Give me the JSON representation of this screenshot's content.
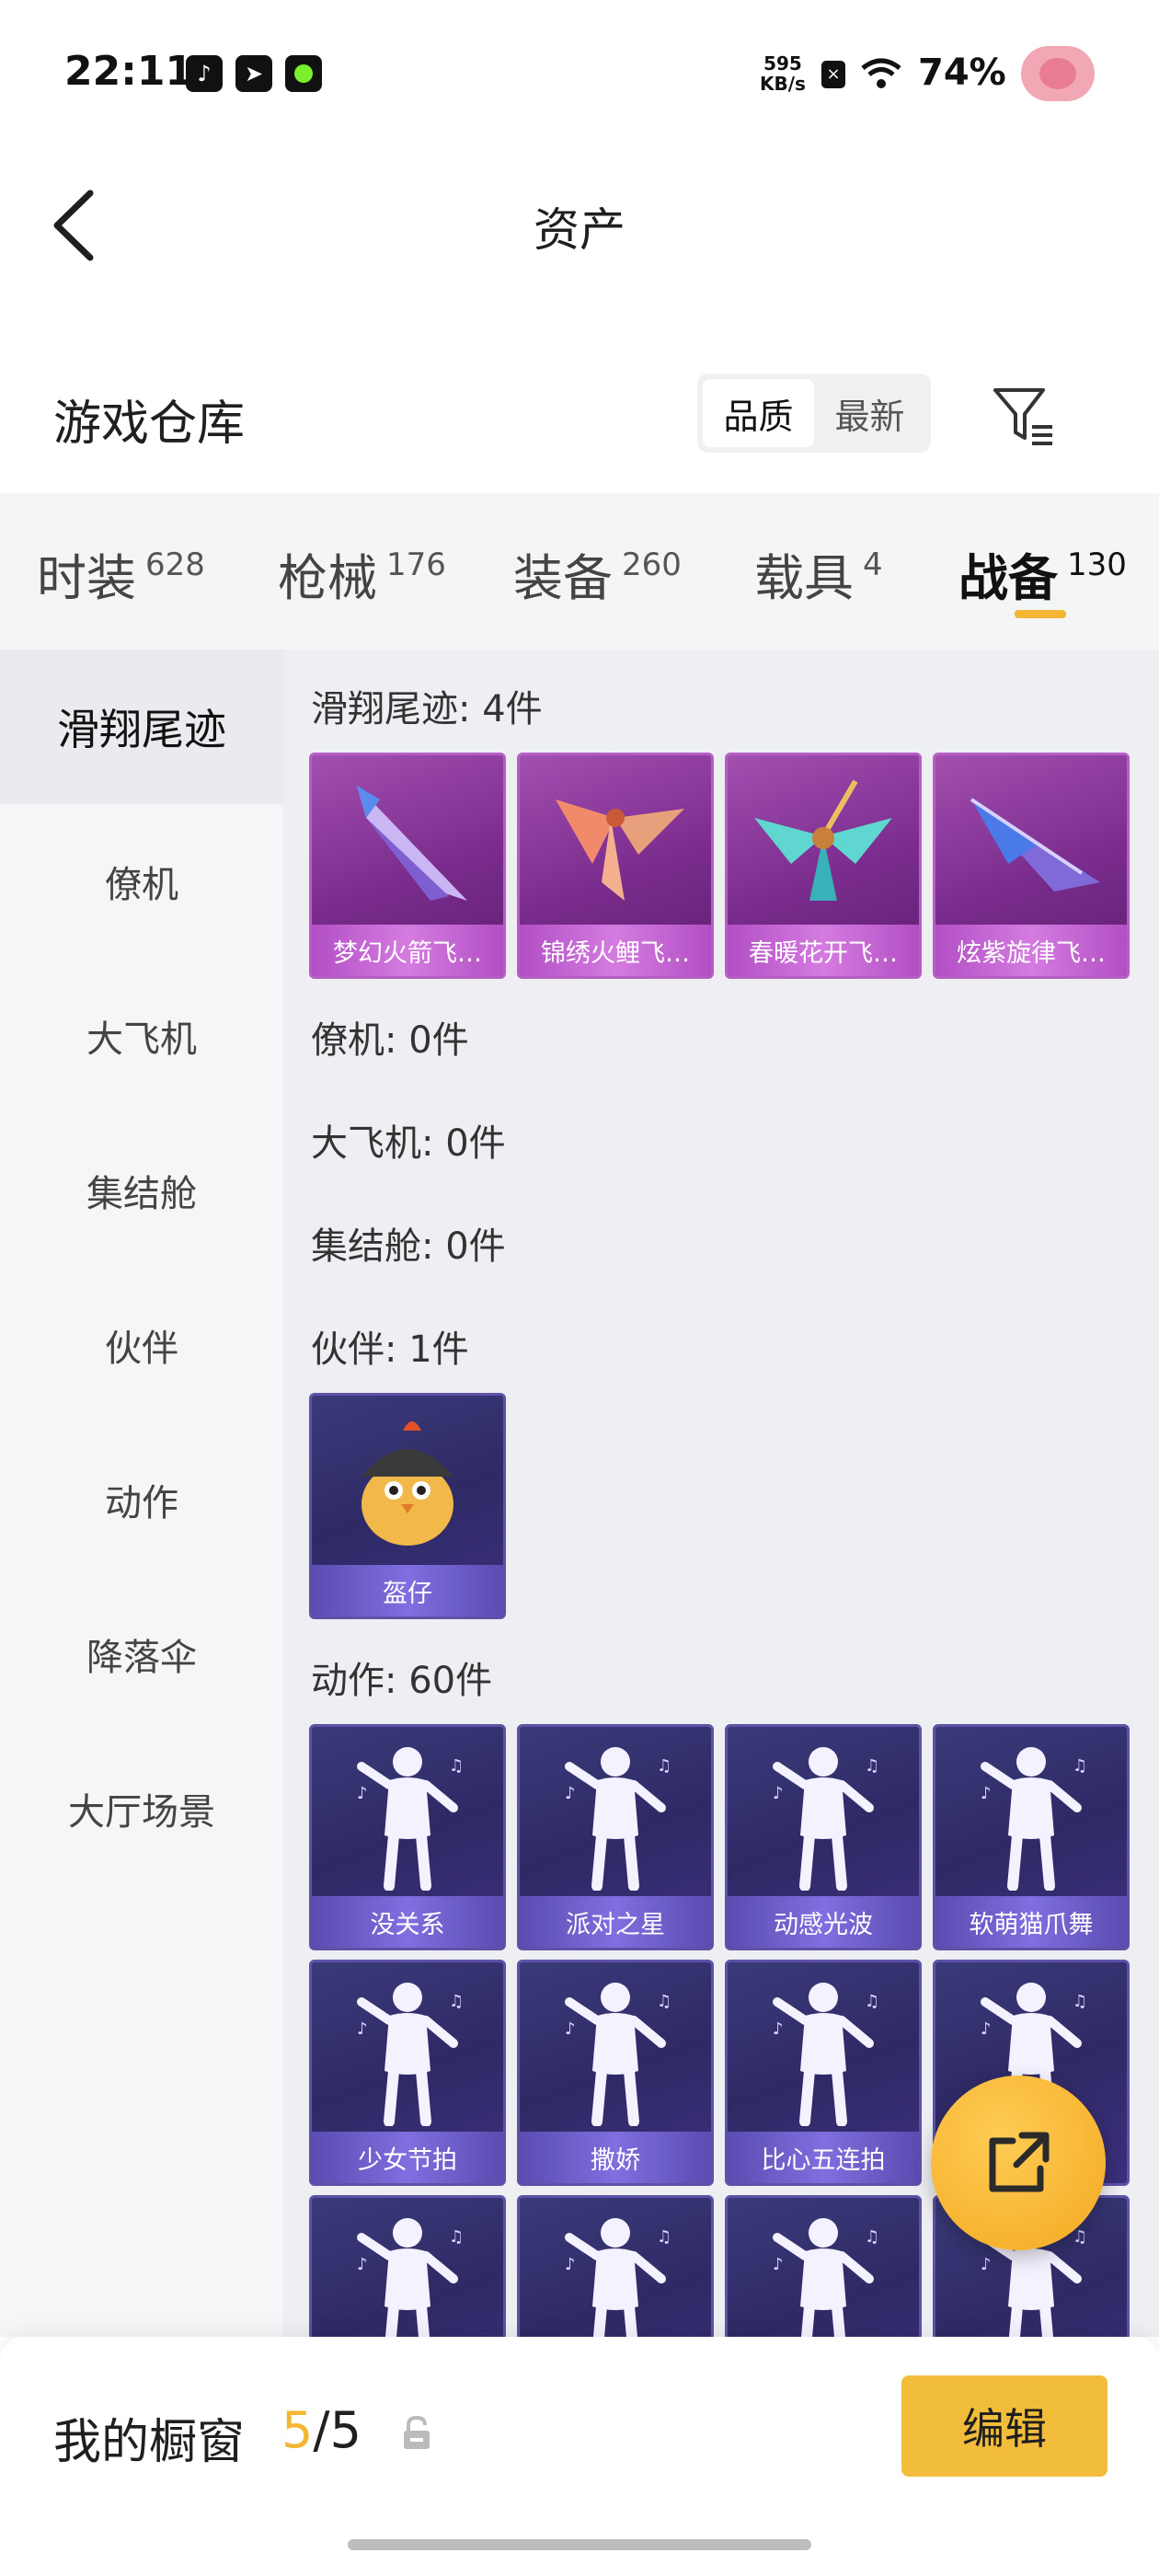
{
  "status_bar": {
    "time": "22:11",
    "net_speed_value": "595",
    "net_speed_unit": "KB/s",
    "battery": "74%"
  },
  "header": {
    "title": "资产"
  },
  "warehouse": {
    "title": "游戏仓库",
    "sort_options": [
      "品质",
      "最新"
    ],
    "active_sort": "品质"
  },
  "category_tabs": [
    {
      "label": "时装",
      "count": "628"
    },
    {
      "label": "枪械",
      "count": "176"
    },
    {
      "label": "装备",
      "count": "260"
    },
    {
      "label": "载具",
      "count": "4"
    },
    {
      "label": "战备",
      "count": "130",
      "active": true
    }
  ],
  "side_nav": [
    "滑翔尾迹",
    "僚机",
    "大飞机",
    "集结舱",
    "伙伴",
    "动作",
    "降落伞",
    "大厅场景"
  ],
  "sections": {
    "glide": {
      "label": "滑翔尾迹: 4件",
      "items": [
        "梦幻火箭飞…",
        "锦绣火鲤飞…",
        "春暖花开飞…",
        "炫紫旋律飞…"
      ]
    },
    "wingman": {
      "label": "僚机: 0件"
    },
    "plane": {
      "label": "大飞机: 0件"
    },
    "pod": {
      "label": "集结舱: 0件"
    },
    "partner": {
      "label": "伙伴: 1件",
      "items": [
        "盔仔"
      ]
    },
    "emote": {
      "label": "动作: 60件",
      "items": [
        "没关系",
        "派对之星",
        "动感光波",
        "软萌猫爪舞",
        "少女节拍",
        "撒娇",
        "比心五连拍",
        "",
        "",
        "",
        "",
        ""
      ]
    }
  },
  "showcase": {
    "title": "我的橱窗",
    "current": "5",
    "separator": "/",
    "total": "5",
    "edit_label": "编辑"
  },
  "colors": {
    "accent": "#f3b733",
    "glide_card": "#7a2c8c",
    "emote_card": "#2f2a66"
  }
}
